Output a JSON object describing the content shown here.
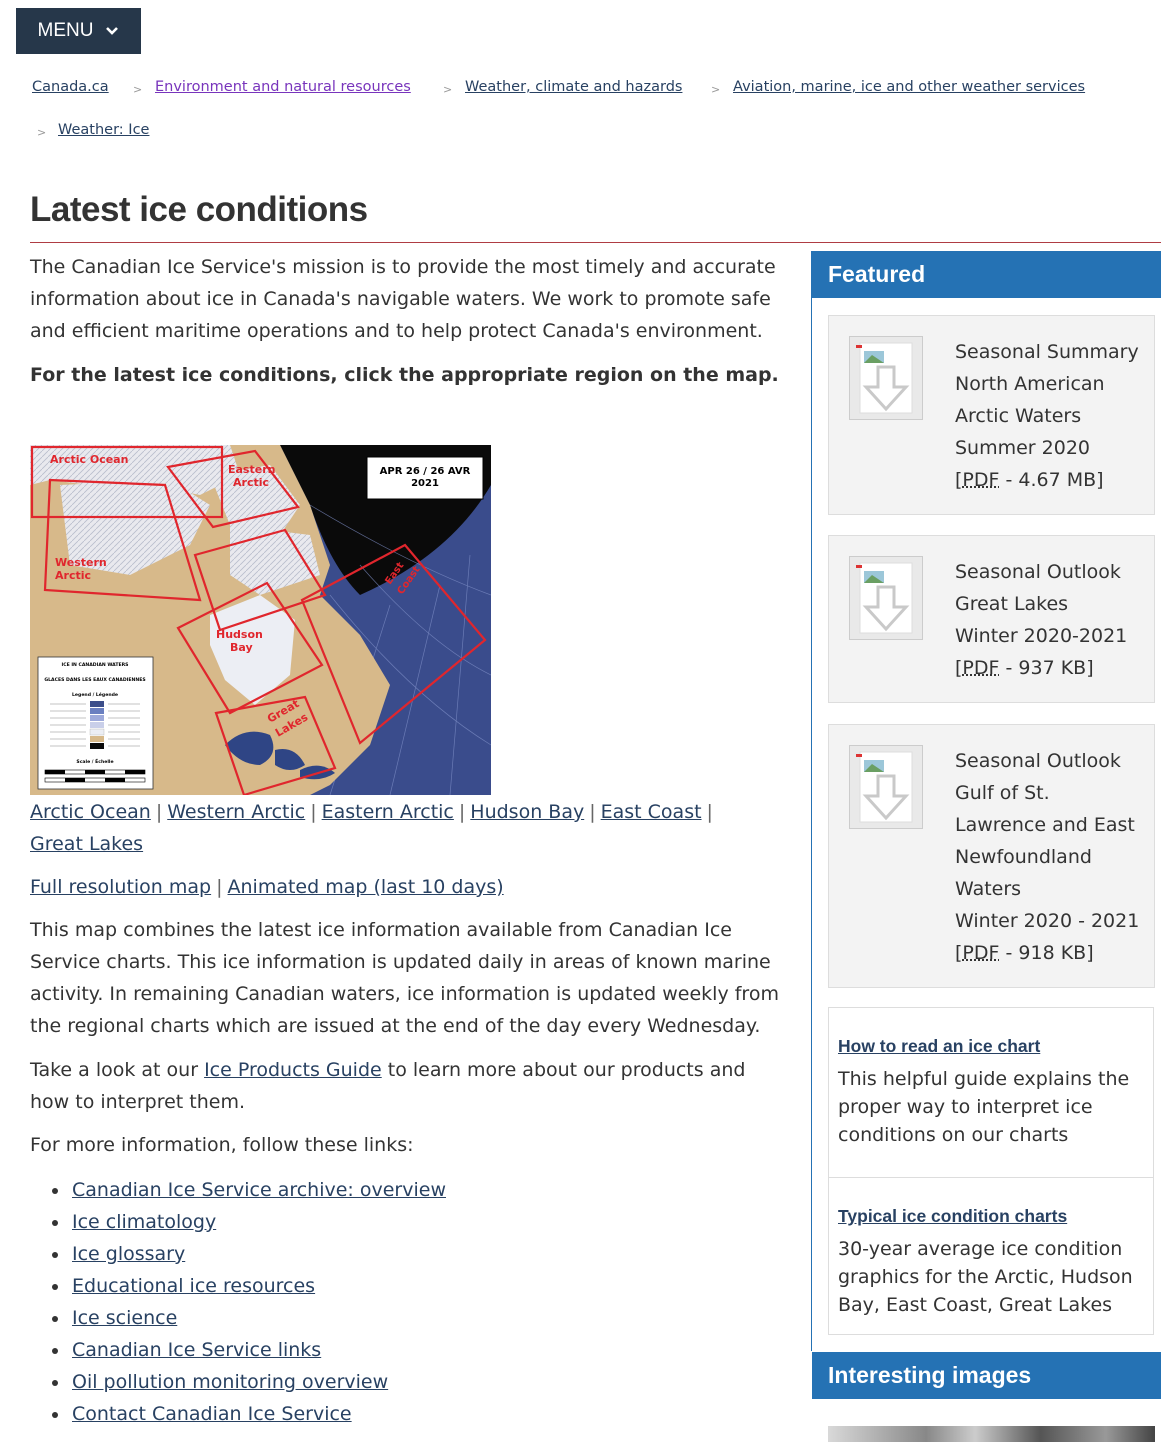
{
  "menu": {
    "label": "MENU"
  },
  "breadcrumb": {
    "items": [
      "Canada.ca",
      "Environment and natural resources",
      "Weather, climate and hazards",
      "Aviation, marine, ice and other weather services",
      "Weather: Ice"
    ],
    "separator": ">"
  },
  "page": {
    "title": "Latest ice conditions",
    "intro": "The Canadian Ice Service's mission is to provide the most timely and accurate information about ice in Canada's navigable waters. We work to promote safe and efficient maritime operations and to help protect Canada's environment.",
    "instruction": "For the latest ice conditions, click the appropriate region on the map.",
    "map": {
      "date_label": "APR 26 / 26 AVR",
      "year_label": "2021",
      "regions": [
        "Arctic Ocean",
        "Eastern Arctic",
        "Western Arctic",
        "Hudson Bay",
        "East Coast",
        "Great Lakes"
      ],
      "legend": {
        "title1": "ICE IN CANADIAN WATERS",
        "title2": "GLACES DANS LES EAUX CANADIENNES",
        "subtitle": "Legend / Légende",
        "scale": "Scale / Échelle"
      }
    },
    "region_links": [
      "Arctic Ocean",
      "Western Arctic",
      "Eastern Arctic",
      "Hudson Bay",
      "East Coast",
      "Great Lakes"
    ],
    "map_links": [
      "Full resolution map",
      "Animated map (last 10 days)"
    ],
    "description": "This map combines the latest ice information available from Canadian Ice Service charts. This ice information is updated daily in areas of known marine activity. In remaining Canadian waters, ice information is updated weekly from the regional charts which are issued at the end of the day every Wednesday.",
    "guide_prefix": "Take a look at our ",
    "guide_link": "Ice Products Guide",
    "guide_suffix": " to learn more about our products and how to interpret them.",
    "more_info": "For more information, follow these links:",
    "more_links": [
      "Canadian Ice Service archive: overview",
      "Ice climatology",
      "Ice glossary",
      "Educational ice resources",
      "Ice science",
      "Canadian Ice Service links",
      "Oil pollution monitoring overview",
      "Contact Canadian Ice Service"
    ]
  },
  "sidebar": {
    "featured_title": "Featured",
    "featured": [
      {
        "lines": [
          "Seasonal Summary",
          "North American",
          "Arctic Waters",
          "Summer 2020"
        ],
        "format": "PDF",
        "size": "4.67 MB"
      },
      {
        "lines": [
          "Seasonal Outlook",
          "Great Lakes",
          "Winter 2020-2021"
        ],
        "format": "PDF",
        "size": "937 KB"
      },
      {
        "lines": [
          "Seasonal Outlook",
          "Gulf of St.",
          "Lawrence and East",
          "Newfoundland",
          "Waters",
          "Winter 2020 - 2021"
        ],
        "format": "PDF",
        "size": "918 KB"
      }
    ],
    "guides": [
      {
        "title": "How to read an ice chart",
        "desc": "This helpful guide explains the proper way to interpret ice conditions on our charts"
      },
      {
        "title": "Typical ice condition charts",
        "desc": "30-year average ice condition graphics for the Arctic, Hudson Bay, East Coast, Great Lakes"
      }
    ],
    "interesting_title": "Interesting images"
  },
  "colors": {
    "brand_dark": "#26374a",
    "accent_blue": "#2572b4",
    "title_rule": "#af3c43",
    "link": "#284162",
    "visited": "#7834bc"
  }
}
